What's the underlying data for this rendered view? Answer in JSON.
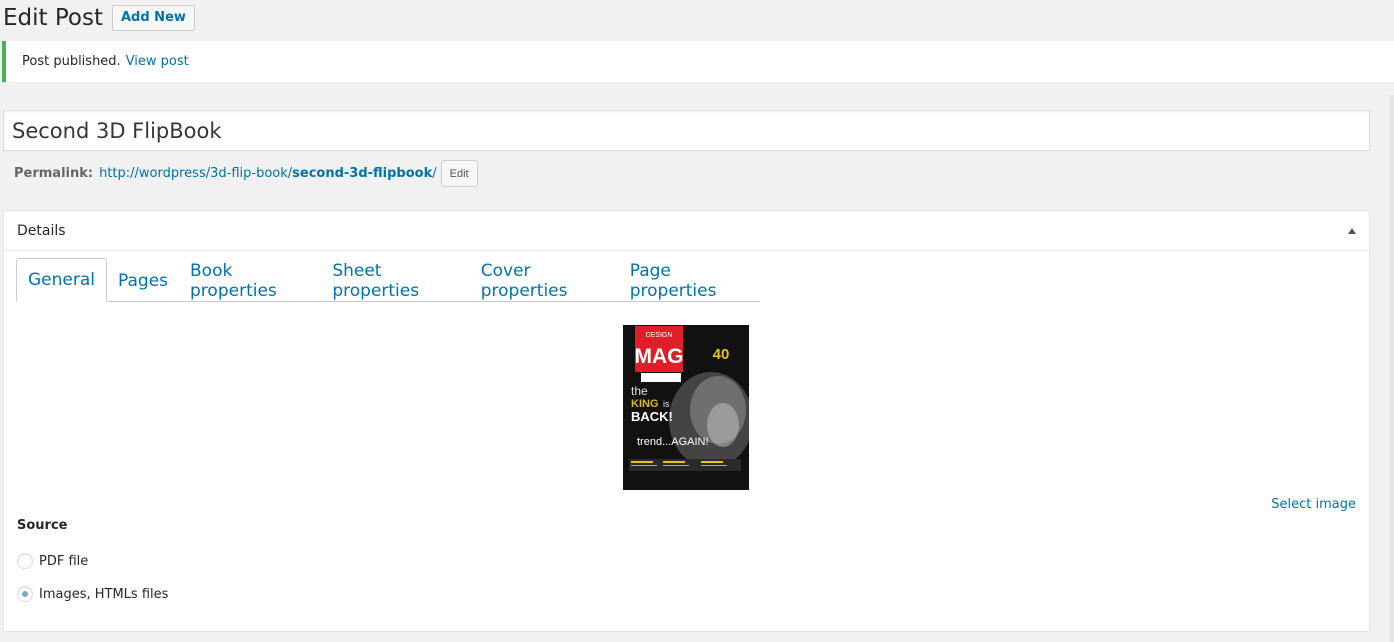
{
  "header": {
    "title": "Edit Post",
    "add_new_label": "Add New"
  },
  "notice": {
    "text": "Post published.",
    "link": "View post",
    "accent": "#46b450"
  },
  "post": {
    "title": "Second 3D FlipBook",
    "permalink_label": "Permalink:",
    "permalink_base": "http://wordpress/3d-flip-book/",
    "permalink_slug": "second-3d-flipbook",
    "permalink_trail": "/",
    "edit_label": "Edit"
  },
  "details": {
    "title": "Details",
    "tabs": [
      {
        "label": "General",
        "active": true
      },
      {
        "label": "Pages"
      },
      {
        "label": "Book properties"
      },
      {
        "label": "Sheet properties"
      },
      {
        "label": "Cover properties"
      },
      {
        "label": "Page properties"
      }
    ],
    "cover": {
      "masthead_top": "DESIGN",
      "masthead": "MAG",
      "corner_number": "40",
      "headline_1": "the",
      "headline_2": "KING",
      "headline_3": "is",
      "headline_4": "BACK!",
      "subline": "trend...AGAIN!"
    },
    "select_image_label": "Select image",
    "source": {
      "label": "Source",
      "options": [
        {
          "label": "PDF file",
          "checked": false
        },
        {
          "label": "Images, HTMLs files",
          "checked": true
        }
      ]
    }
  },
  "colors": {
    "link": "#0073aa",
    "background": "#f1f1f1"
  }
}
